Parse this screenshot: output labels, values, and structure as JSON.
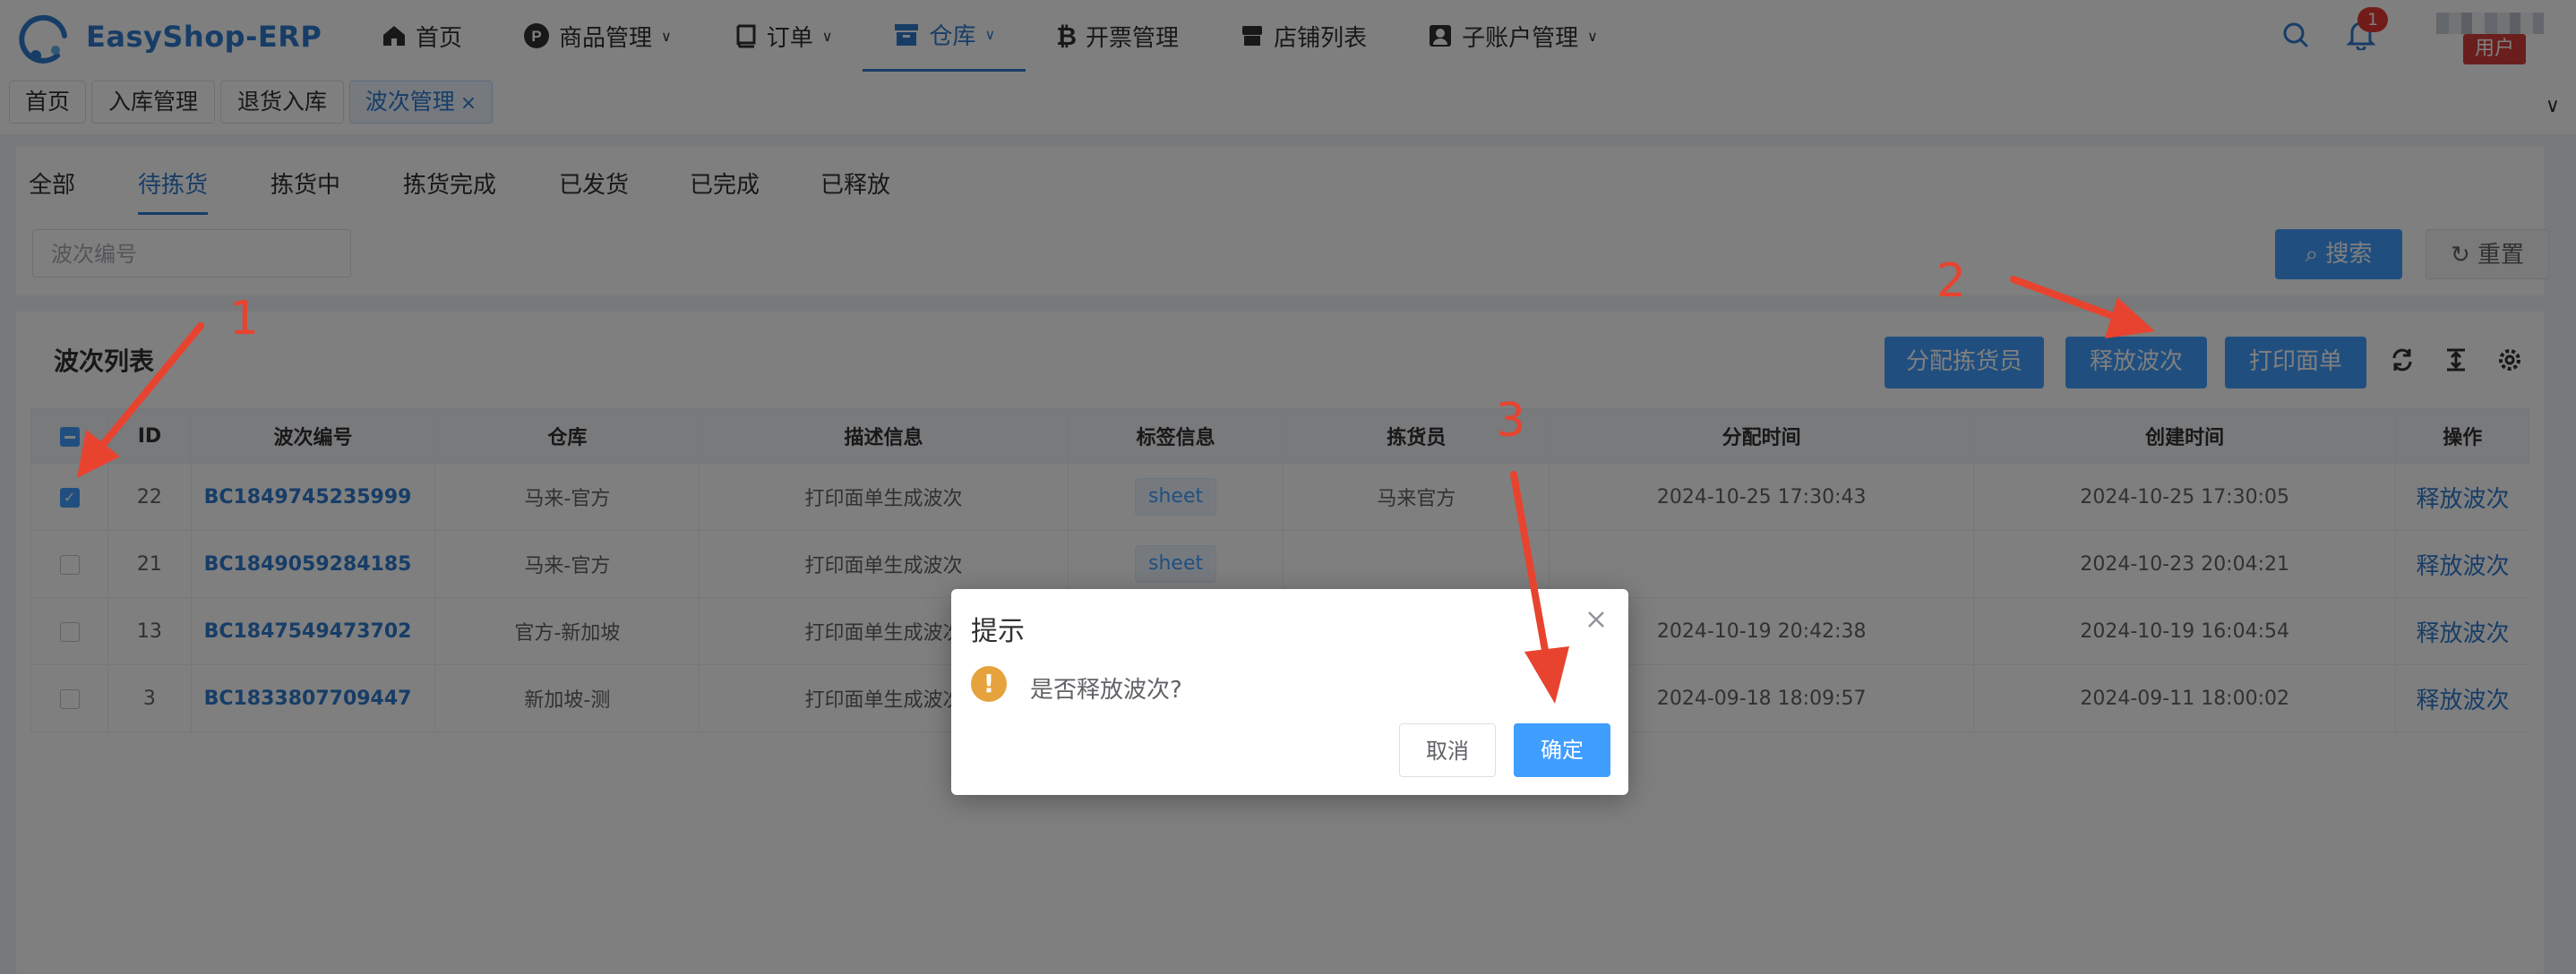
{
  "app": {
    "title": "EasyShop-ERP"
  },
  "nav": {
    "home": "首页",
    "products": "商品管理",
    "orders": "订单",
    "warehouse": "仓库",
    "invoice": "开票管理",
    "stores": "店铺列表",
    "subaccounts": "子账户管理"
  },
  "header": {
    "notification_count": "1",
    "user_label": "用户"
  },
  "tags": {
    "home": "首页",
    "inbound": "入库管理",
    "return": "退货入库",
    "wave": "波次管理",
    "close": "×"
  },
  "status_tabs": [
    "全部",
    "待拣货",
    "拣货中",
    "拣货完成",
    "已发货",
    "已完成",
    "已释放"
  ],
  "search": {
    "placeholder": "波次编号",
    "search_label": "搜索",
    "reset_label": "重置"
  },
  "list": {
    "title": "波次列表",
    "assign_label": "分配拣货员",
    "release_label": "释放波次",
    "print_label": "打印面单"
  },
  "table": {
    "headers": [
      "ID",
      "波次编号",
      "仓库",
      "描述信息",
      "标签信息",
      "拣货员",
      "分配时间",
      "创建时间",
      "操作"
    ],
    "rows": [
      {
        "checked": true,
        "id": "22",
        "code": "BC1849745235999",
        "warehouse": "马来-官方",
        "desc": "打印面单生成波次",
        "tag": "sheet",
        "picker": "马来官方",
        "assign_time": "2024-10-25 17:30:43",
        "create_time": "2024-10-25 17:30:05",
        "op": "释放波次"
      },
      {
        "checked": false,
        "id": "21",
        "code": "BC1849059284185",
        "warehouse": "马来-官方",
        "desc": "打印面单生成波次",
        "tag": "sheet",
        "picker": "",
        "assign_time": "",
        "create_time": "2024-10-23 20:04:21",
        "op": "释放波次"
      },
      {
        "checked": false,
        "id": "13",
        "code": "BC1847549473702",
        "warehouse": "官方-新加坡",
        "desc": "打印面单生成波次",
        "tag": "",
        "picker": "",
        "assign_time": "2024-10-19 20:42:38",
        "create_time": "2024-10-19 16:04:54",
        "op": "释放波次"
      },
      {
        "checked": false,
        "id": "3",
        "code": "BC1833807709447",
        "warehouse": "新加坡-测",
        "desc": "打印面单生成波次",
        "tag": "",
        "picker": "",
        "assign_time": "2024-09-18 18:09:57",
        "create_time": "2024-09-11 18:00:02",
        "op": "释放波次"
      }
    ]
  },
  "dialog": {
    "title": "提示",
    "message": "是否释放波次?",
    "cancel_label": "取消",
    "confirm_label": "确定"
  },
  "annotations": [
    "1",
    "2",
    "3"
  ],
  "colors": {
    "primary": "#409eff",
    "brand": "#2e7bcf",
    "annotation": "#e8432f",
    "warning": "#e6a23c"
  }
}
